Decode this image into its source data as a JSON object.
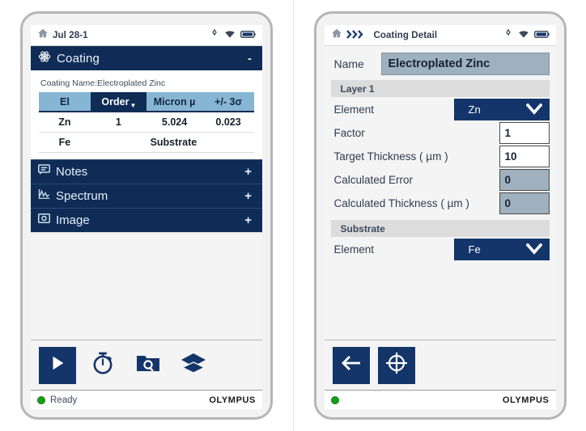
{
  "left": {
    "statusbar": {
      "title": "Jul 28-1",
      "home_icon": "home-icon",
      "icons": [
        "target-icon",
        "wifi-icon",
        "battery-icon"
      ]
    },
    "section": {
      "icon": "atom-icon",
      "title": "Coating",
      "toggle": "-"
    },
    "coating_name_label": "Coating Name:Electroplated Zinc",
    "table": {
      "headers": [
        "El",
        "Order",
        "Micron µ",
        "+/- 3σ"
      ],
      "sorted_column": "Order",
      "rows": [
        {
          "el": "Zn",
          "order": "1",
          "micron": "5.024",
          "sigma": "0.023"
        },
        {
          "el": "Fe",
          "order": "Substrate",
          "micron": "",
          "sigma": ""
        }
      ]
    },
    "accordion": [
      {
        "icon": "notes-icon",
        "label": "Notes",
        "sign": "+"
      },
      {
        "icon": "spectrum-icon",
        "label": "Spectrum",
        "sign": "+"
      },
      {
        "icon": "image-icon",
        "label": "Image",
        "sign": "+"
      }
    ],
    "toolbar": [
      {
        "name": "play-button",
        "icon": "play-icon",
        "filled": true
      },
      {
        "name": "timer-button",
        "icon": "stopwatch-icon",
        "filled": false
      },
      {
        "name": "search-folder-button",
        "icon": "folder-search-icon",
        "filled": false
      },
      {
        "name": "layers-button",
        "icon": "layers-icon",
        "filled": false
      }
    ],
    "footer": {
      "status": "Ready",
      "brand": "OLYMPUS"
    }
  },
  "right": {
    "statusbar": {
      "home_icon": "home-icon",
      "breadcrumb": "»»",
      "title": "Coating Detail",
      "icons": [
        "target-icon",
        "wifi-icon",
        "battery-icon"
      ]
    },
    "name_row": {
      "label": "Name",
      "value": "Electroplated Zinc"
    },
    "layer_group": {
      "title": "Layer 1"
    },
    "layer_fields": [
      {
        "label": "Element",
        "value": "Zn",
        "type": "select"
      },
      {
        "label": "Factor",
        "value": "1",
        "type": "input"
      },
      {
        "label": "Target Thickness ( µm )",
        "value": "10",
        "type": "input"
      },
      {
        "label": "Calculated Error",
        "value": "0",
        "type": "readonly"
      },
      {
        "label": "Calculated Thickness ( µm )",
        "value": "0",
        "type": "readonly"
      }
    ],
    "substrate_group": {
      "title": "Substrate"
    },
    "substrate_fields": [
      {
        "label": "Element",
        "value": "Fe",
        "type": "select"
      }
    ],
    "toolbar": [
      {
        "name": "back-button",
        "icon": "arrow-left-icon"
      },
      {
        "name": "calibrate-button",
        "icon": "crosshair-circle-icon"
      }
    ],
    "footer": {
      "status": "",
      "brand": "OLYMPUS"
    }
  },
  "colors": {
    "navy": "#0e2c56",
    "button_navy": "#13356a",
    "header_blue": "#87b6d4",
    "readonly_gray": "#9fb0bf",
    "status_green": "#16a015"
  }
}
